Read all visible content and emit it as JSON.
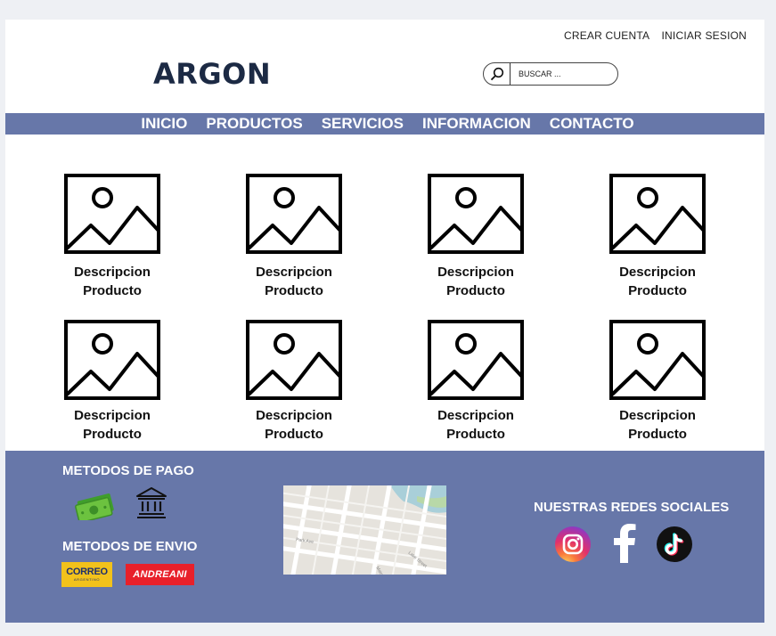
{
  "header": {
    "top_links": [
      "CREAR CUENTA",
      "INICIAR SESION"
    ],
    "logo": "ARGON",
    "search_placeholder": "BUSCAR ..."
  },
  "nav": {
    "items": [
      "INICIO",
      "PRODUCTOS",
      "SERVICIOS",
      "INFORMACION",
      "CONTACTO"
    ]
  },
  "products": [
    {
      "line1": "Descripcion",
      "line2": "Producto"
    },
    {
      "line1": "Descripcion",
      "line2": "Producto"
    },
    {
      "line1": "Descripcion",
      "line2": "Producto"
    },
    {
      "line1": "Descripcion",
      "line2": "Producto"
    },
    {
      "line1": "Descripcion",
      "line2": "Producto"
    },
    {
      "line1": "Descripcion",
      "line2": "Producto"
    },
    {
      "line1": "Descripcion",
      "line2": "Producto"
    },
    {
      "line1": "Descripcion",
      "line2": "Producto"
    }
  ],
  "footer": {
    "payment_title": "METODOS DE PAGO",
    "shipping_title": "METODOS DE ENVIO",
    "social_title": "NUESTRAS REDES SOCIALES",
    "correo_label": "CORREO",
    "correo_sub": "ARGENTINO",
    "andreani_label": "ANDREANI",
    "map_streets": [
      "Park Ave",
      "Main St",
      "Lake Street"
    ]
  },
  "colors": {
    "nav_bg": "#6777a9",
    "footer_bg": "#6777a9",
    "logo": "#1c2a44",
    "andreani": "#e8202a",
    "correo": "#f2c21b"
  }
}
